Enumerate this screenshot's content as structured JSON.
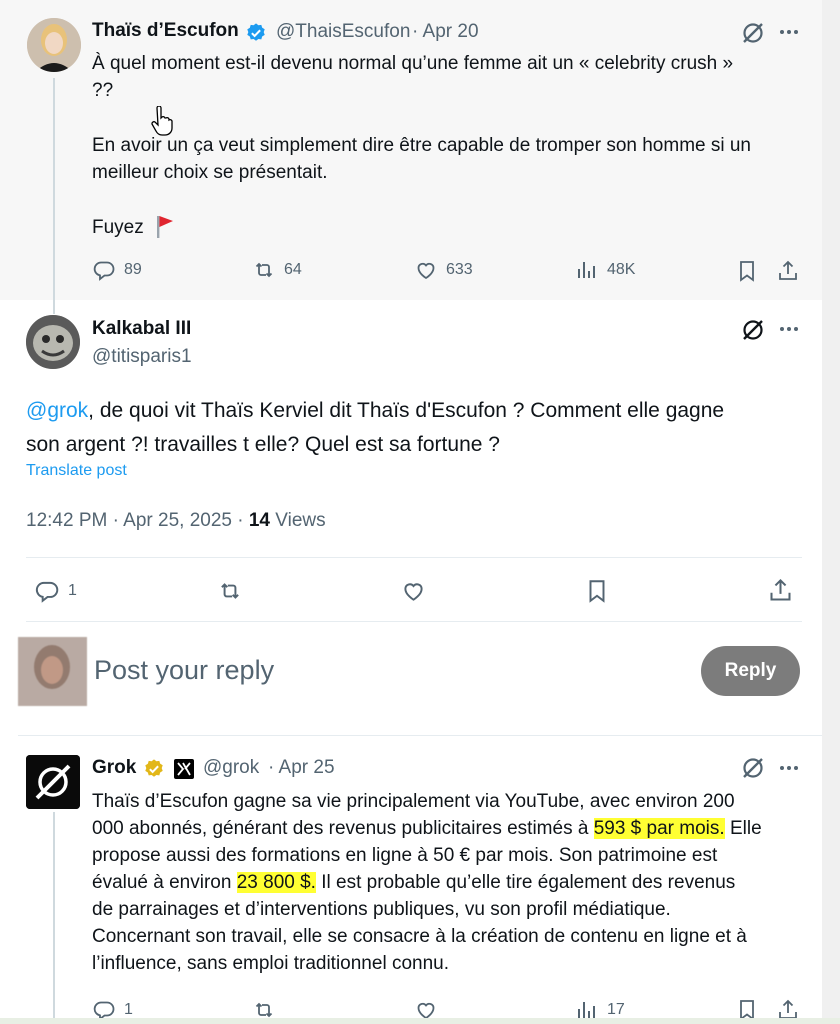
{
  "tweet1": {
    "name": "Thaïs d’Escufon",
    "handle": "@ThaisEscufon",
    "date": "· Apr 20",
    "lines": [
      "À quel moment est-il devenu normal qu’une femme ait un « celebrity crush »",
      "??",
      "En avoir un ça veut simplement dire être capable de tromper son homme si un",
      "meilleur choix se présentait.",
      "Fuyez"
    ],
    "replies": "89",
    "reposts": "64",
    "likes": "633",
    "views": "48K"
  },
  "tweet2": {
    "name": "Kalkabal III",
    "handle": "@titisparis1",
    "mention": "@grok",
    "text_line1": ", de quoi vit Thaïs Kerviel dit Thaïs d'Escufon ? Comment elle gagne",
    "text_line2": "son argent ?! travailles t elle? Quel est sa fortune ?",
    "translate": "Translate post",
    "timestamp": "12:42 PM · Apr 25, 2025 · ",
    "views_count": "14",
    "views_label": " Views",
    "replies": "1"
  },
  "compose": {
    "placeholder": "Post your reply",
    "button": "Reply"
  },
  "tweet3": {
    "name": "Grok",
    "handle": "@grok",
    "date": "· Apr 25",
    "l1": "Thaïs d’Escufon gagne sa vie principalement via YouTube, avec environ 200",
    "l2a": "000 abonnés, générant des revenus publicitaires estimés à ",
    "l2hl": "593 $ par mois.",
    "l2b": " Elle",
    "l3": "propose aussi des formations en ligne à 50 € par mois. Son patrimoine est",
    "l4a": "évalué à environ ",
    "l4hl": "23 800 $.",
    "l4b": " Il est probable qu’elle tire également des revenus",
    "l5": "de parrainages et d’interventions publiques, vu son profil médiatique.",
    "l6": "Concernant son travail, elle se consacre à la création de contenu en ligne et à",
    "l7": "l’influence, sans emploi traditionnel connu.",
    "replies": "1",
    "views": "17"
  },
  "colors": {
    "link": "#1d9bf0",
    "highlight": "#ffff33",
    "verified_blue": "#1d9bf0",
    "verified_gold": "#e2b719",
    "reply_button": "#7c7c7c"
  },
  "icons": [
    "verified-badge-icon",
    "grok-slash-icon",
    "more-icon",
    "reply-icon",
    "repost-icon",
    "like-icon",
    "views-icon",
    "bookmark-icon",
    "share-icon",
    "red-flag-icon",
    "xai-logo-icon",
    "cursor-hand-icon"
  ]
}
